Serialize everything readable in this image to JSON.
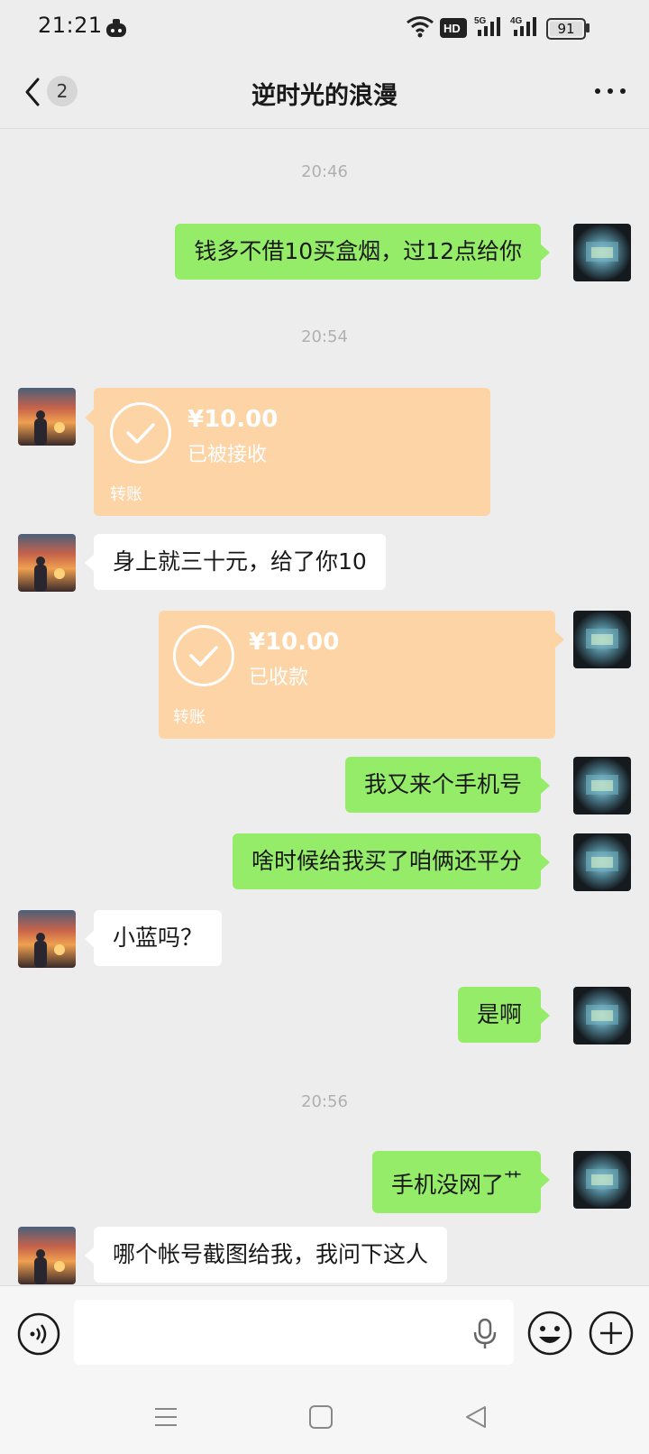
{
  "status_bar": {
    "time": "21:21",
    "battery": "91"
  },
  "nav": {
    "back_badge": "2",
    "title": "逆时光的浪漫"
  },
  "timestamps": [
    "20:46",
    "20:54",
    "20:56"
  ],
  "messages": [
    {
      "side": "right",
      "type": "text",
      "text": "钱多不借10买盒烟，过12点给你"
    },
    {
      "side": "left",
      "type": "transfer",
      "amount": "¥10.00",
      "status": "已被接收",
      "label": "转账"
    },
    {
      "side": "left",
      "type": "text",
      "text": "身上就三十元，给了你10"
    },
    {
      "side": "right",
      "type": "transfer",
      "amount": "¥10.00",
      "status": "已收款",
      "label": "转账"
    },
    {
      "side": "right",
      "type": "text",
      "text": "我又来个手机号"
    },
    {
      "side": "right",
      "type": "text",
      "text": "啥时候给我买了咱俩还平分"
    },
    {
      "side": "left",
      "type": "text",
      "text": "小蓝吗？"
    },
    {
      "side": "right",
      "type": "text",
      "text": "是啊"
    },
    {
      "side": "right",
      "type": "text",
      "text": "手机没网了"
    },
    {
      "side": "left",
      "type": "text",
      "text": "哪个帐号截图给我，我问下这人"
    }
  ],
  "emoji_after_msg8": "艹",
  "colors": {
    "bg": "#ededed",
    "green_bubble": "#95ec69",
    "transfer": "#fcd4a6"
  },
  "icons": [
    "voice-toggle-icon",
    "mic-icon",
    "emoji-icon",
    "plus-icon",
    "menu-icon",
    "home-icon",
    "back-icon"
  ]
}
